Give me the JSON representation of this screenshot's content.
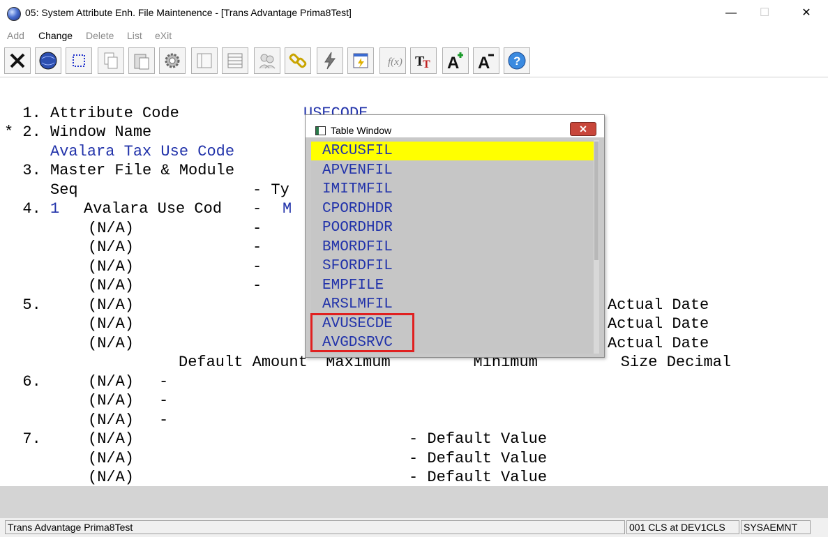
{
  "window": {
    "title": "05: System Attribute Enh. File Maintenence - [Trans Advantage  Prima8Test]",
    "minimize": "—",
    "maximize": "☐",
    "close": "✕"
  },
  "menu": [
    {
      "label": "Add",
      "enabled": false
    },
    {
      "label": "Change",
      "enabled": true
    },
    {
      "label": "Delete",
      "enabled": false
    },
    {
      "label": "List",
      "enabled": false
    },
    {
      "label": "eXit",
      "enabled": false
    }
  ],
  "toolbar": {
    "icons": [
      "exit-icon",
      "globe-icon",
      "select-icon",
      "copy-icon",
      "paste-icon",
      "settings-icon",
      "form-icon",
      "table-icon",
      "users-icon",
      "link-icon",
      "lightning-icon",
      "report-icon",
      "function-icon",
      "font-icon",
      "font-increase-icon",
      "font-decrease-icon",
      "help-icon"
    ]
  },
  "terminal": {
    "lines": [
      {
        "text": "  1. Attribute Code",
        "color": "black"
      },
      {
        "text": "* 2. Window Name",
        "color": "black"
      },
      {
        "text": "     Avalara Tax Use Code",
        "color": "blue"
      },
      {
        "text": "  3. Master File & Module",
        "color": "black"
      },
      {
        "text": "     Seq",
        "color": "black"
      },
      {
        "text": "  4.",
        "color": "black"
      },
      {
        "text": "     1",
        "color": "blue"
      },
      {
        "text": "Avalara Use Cod",
        "color": "black"
      },
      {
        "text": "(N/A)",
        "color": "black"
      },
      {
        "text": "  5.",
        "color": "black"
      },
      {
        "text": "Default Amount  Maximum         Minimum         Size Decimal",
        "color": "black"
      },
      {
        "text": "  6.",
        "color": "black"
      },
      {
        "text": "  7.",
        "color": "black"
      },
      {
        "text": "- Default Value",
        "color": "black"
      },
      {
        "text": "Actual Date",
        "color": "black"
      },
      {
        "text": "USECODE",
        "color": "blue"
      },
      {
        "text": "- Ty",
        "color": "black"
      },
      {
        "text": "-",
        "color": "black"
      },
      {
        "text": "M",
        "color": "blue"
      }
    ]
  },
  "table_window": {
    "title": "Table Window",
    "close": "✕",
    "items": [
      "ARCUSFIL",
      "APVENFIL",
      "IMITMFIL",
      "CPORDHDR",
      "POORDHDR",
      "BMORDFIL",
      "SFORDFIL",
      "EMPFILE",
      "ARSLMFIL",
      "AVUSECDE",
      "AVGDSRVC"
    ],
    "selected_index": 0
  },
  "status": {
    "company": "Trans Advantage  Prima8Test",
    "session": "001 CLS at DEV1CLS",
    "program": "SYSAEMNT"
  }
}
